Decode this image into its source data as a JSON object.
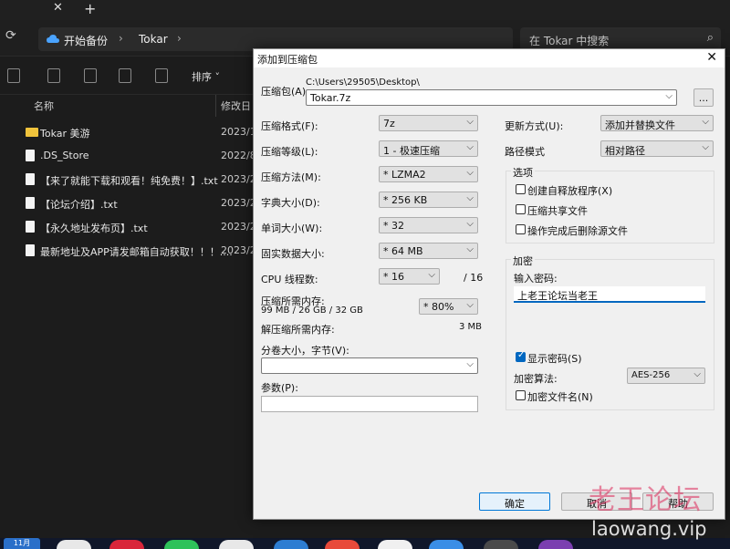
{
  "explorer": {
    "tab_close": "✕",
    "tab_new": "+",
    "address_home": "开始备份",
    "address_folder": "Tokar",
    "address_sep": "›",
    "search_placeholder": "在 Tokar 中搜索",
    "sort_label": "排序 ˅",
    "col_name": "名称",
    "col_date": "修改日",
    "files": [
      {
        "name": "Tokar 美游",
        "date": "2023/1",
        "type": "folder"
      },
      {
        "name": ".DS_Store",
        "date": "2022/8",
        "type": "file"
      },
      {
        "name": "【来了就能下载和观看！纯免费！】.txt",
        "date": "2023/2",
        "type": "file"
      },
      {
        "name": "【论坛介绍】.txt",
        "date": "2023/2",
        "type": "file"
      },
      {
        "name": "【永久地址发布页】.txt",
        "date": "2023/2",
        "type": "file"
      },
      {
        "name": "最新地址及APP请发邮箱自动获取！！！....",
        "date": "2023/2",
        "type": "file"
      }
    ],
    "taskbar_calendar": "11月"
  },
  "dialog": {
    "title": "添加到压缩包",
    "close": "✕",
    "archive_label": "压缩包(A)",
    "archive_path": "C:\\Users\\29505\\Desktop\\",
    "archive_name": "Tokar.7z",
    "browse_btn": "...",
    "format_label": "压缩格式(F):",
    "format_value": "7z",
    "level_label": "压缩等级(L):",
    "level_value": "1 - 极速压缩",
    "method_label": "压缩方法(M):",
    "method_value": "*  LZMA2",
    "dict_label": "字典大小(D):",
    "dict_value": "*  256 KB",
    "word_label": "单词大小(W):",
    "word_value": "*  32",
    "solid_label": "固实数据大小:",
    "solid_value": "*  64 MB",
    "cpu_label": "CPU 线程数:",
    "cpu_value": "*  16",
    "cpu_total": "/ 16",
    "mem_label": "压缩所需内存:",
    "mem_value": "99 MB / 26 GB / 32 GB",
    "mem_pct": "*  80%",
    "decomp_label": "解压缩所需内存:",
    "decomp_value": "3 MB",
    "split_label": "分卷大小，字节(V):",
    "split_value": "",
    "params_label": "参数(P):",
    "params_value": "",
    "update_label": "更新方式(U):",
    "update_value": "添加并替换文件",
    "path_label": "路径模式",
    "path_value": "相对路径",
    "options_title": "选项",
    "opt_sfx": "创建自释放程序(X)",
    "opt_shared": "压缩共享文件",
    "opt_delete": "操作完成后删除源文件",
    "enc_title": "加密",
    "enc_pwd_label": "输入密码:",
    "enc_pwd_value": "上老王论坛当老王",
    "enc_show": "显示密码(S)",
    "enc_method_label": "加密算法:",
    "enc_method_value": "AES-256",
    "enc_names": "加密文件名(N)",
    "ok_btn": "确定",
    "cancel_btn": "取消",
    "help_btn": "帮助",
    "arrow": "⌵"
  },
  "watermark": {
    "cn": "老王论坛",
    "url": "laowang.vip"
  }
}
